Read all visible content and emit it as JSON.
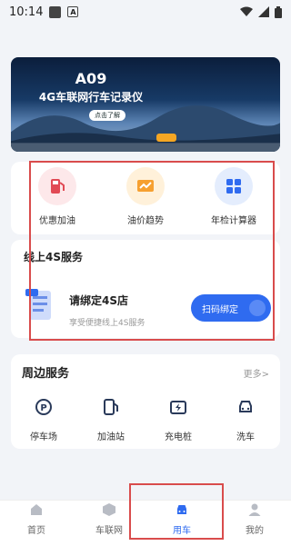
{
  "status": {
    "time": "10:14"
  },
  "banner": {
    "title": "A09",
    "subtitle": "4G车联网行车记录仪",
    "button": "点击了解"
  },
  "quick": {
    "items": [
      {
        "label": "优惠加油",
        "icon": "fuel-icon"
      },
      {
        "label": "油价趋势",
        "icon": "trend-icon"
      },
      {
        "label": "年检计算器",
        "icon": "calculator-icon"
      }
    ]
  },
  "service4s": {
    "header": "线上4S服务",
    "title": "请绑定4S店",
    "subtitle": "享受便捷线上4S服务",
    "button": "扫码绑定"
  },
  "nearby": {
    "title": "周边服务",
    "more": "更多>",
    "items": [
      {
        "label": "停车场"
      },
      {
        "label": "加油站"
      },
      {
        "label": "充电桩"
      },
      {
        "label": "洗车"
      }
    ]
  },
  "tabs": [
    {
      "label": "首页"
    },
    {
      "label": "车联网"
    },
    {
      "label": "用车"
    },
    {
      "label": "我的"
    }
  ],
  "colors": {
    "accent": "#2f6bf0",
    "highlight_box": "#d94c4c"
  }
}
